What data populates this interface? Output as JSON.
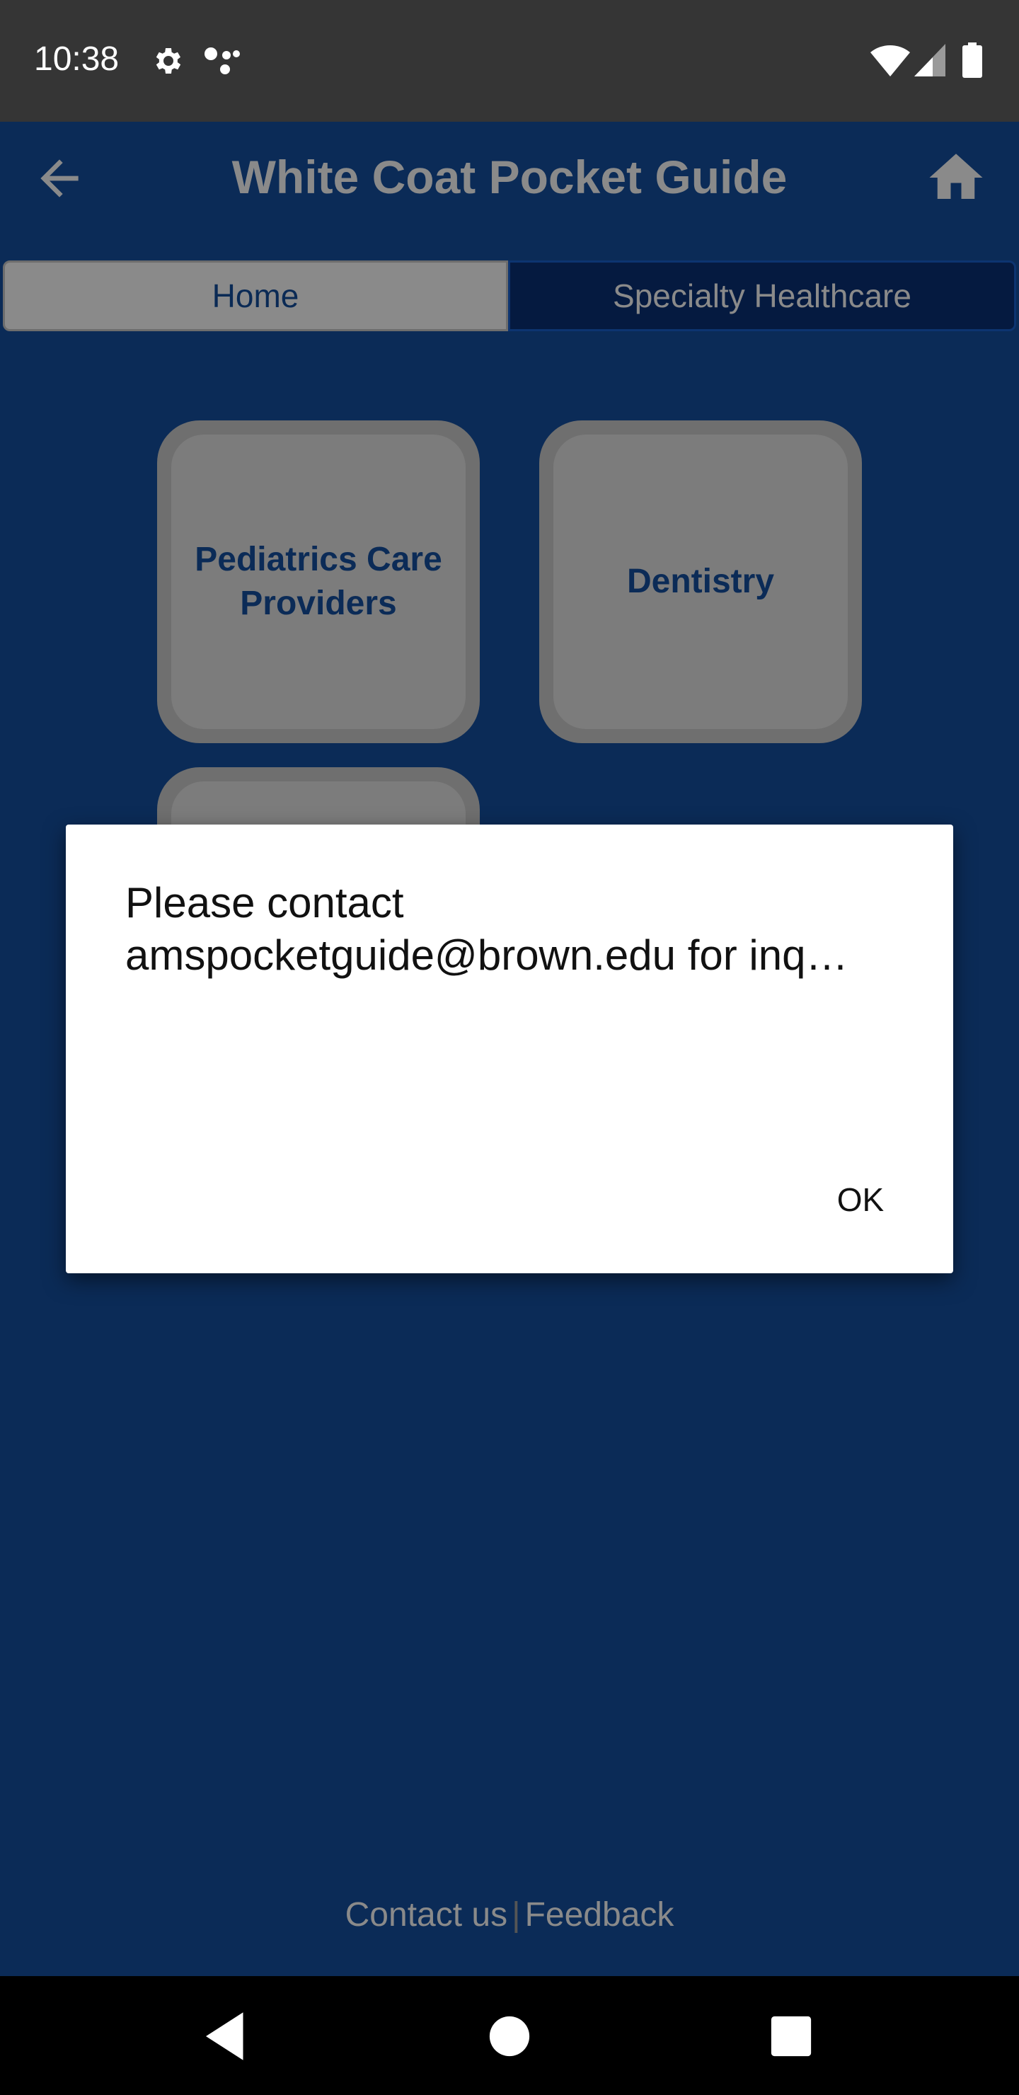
{
  "status_bar": {
    "time": "10:38",
    "icons": [
      "settings-icon",
      "assistant-dots-icon",
      "wifi-icon",
      "signal-icon",
      "battery-icon"
    ]
  },
  "app_bar": {
    "title": "White Coat Pocket Guide",
    "back_icon": "arrow-back-icon",
    "home_icon": "home-icon"
  },
  "tabs": [
    {
      "label": "Home"
    },
    {
      "label": "Specialty Healthcare"
    }
  ],
  "tiles": [
    {
      "label": "Pediatrics Care Providers"
    },
    {
      "label": "Dentistry"
    },
    {
      "label": ""
    }
  ],
  "footer": {
    "contact": "Contact us",
    "separator": "|",
    "feedback": "Feedback"
  },
  "dialog": {
    "line1": "Please contact",
    "line2": "amspocketguide@brown.edu for inq…",
    "ok_label": "OK"
  },
  "nav_bar": {
    "icons": [
      "back-triangle-icon",
      "home-circle-icon",
      "recents-square-icon"
    ]
  },
  "colors": {
    "background": "#0b2b57",
    "status_bar": "#353535",
    "tile": "#7c7c7c",
    "dialog": "#ffffff"
  }
}
